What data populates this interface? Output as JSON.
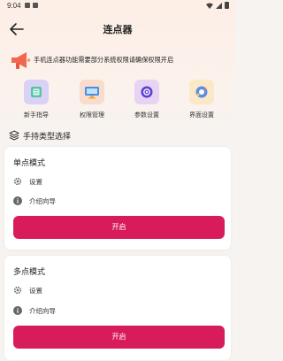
{
  "status_bar": {
    "time": "9:04"
  },
  "app_bar": {
    "title": "连点器"
  },
  "notice": {
    "text": "手机连点器功能需要部分系统权限请确保权限开启"
  },
  "quick_actions": [
    {
      "label": "新手指导",
      "icon": "guide-book-icon",
      "color": "#d9d2f6"
    },
    {
      "label": "权限管理",
      "icon": "permission-monitor-icon",
      "color": "#f9dccb"
    },
    {
      "label": "参数设置",
      "icon": "settings-gear-icon",
      "color": "#e7d3f3"
    },
    {
      "label": "界面设置",
      "icon": "interface-palette-icon",
      "color": "#fbe8c8"
    }
  ],
  "section": {
    "title": "手持类型选择"
  },
  "cards": [
    {
      "title": "单点模式",
      "settings_label": "设置",
      "guide_label": "介绍向导",
      "start_label": "开启"
    },
    {
      "title": "多点模式",
      "settings_label": "设置",
      "guide_label": "介绍向导",
      "start_label": "开启"
    }
  ],
  "colors": {
    "accent": "#d81b5a",
    "background": "#f6f3f0"
  }
}
